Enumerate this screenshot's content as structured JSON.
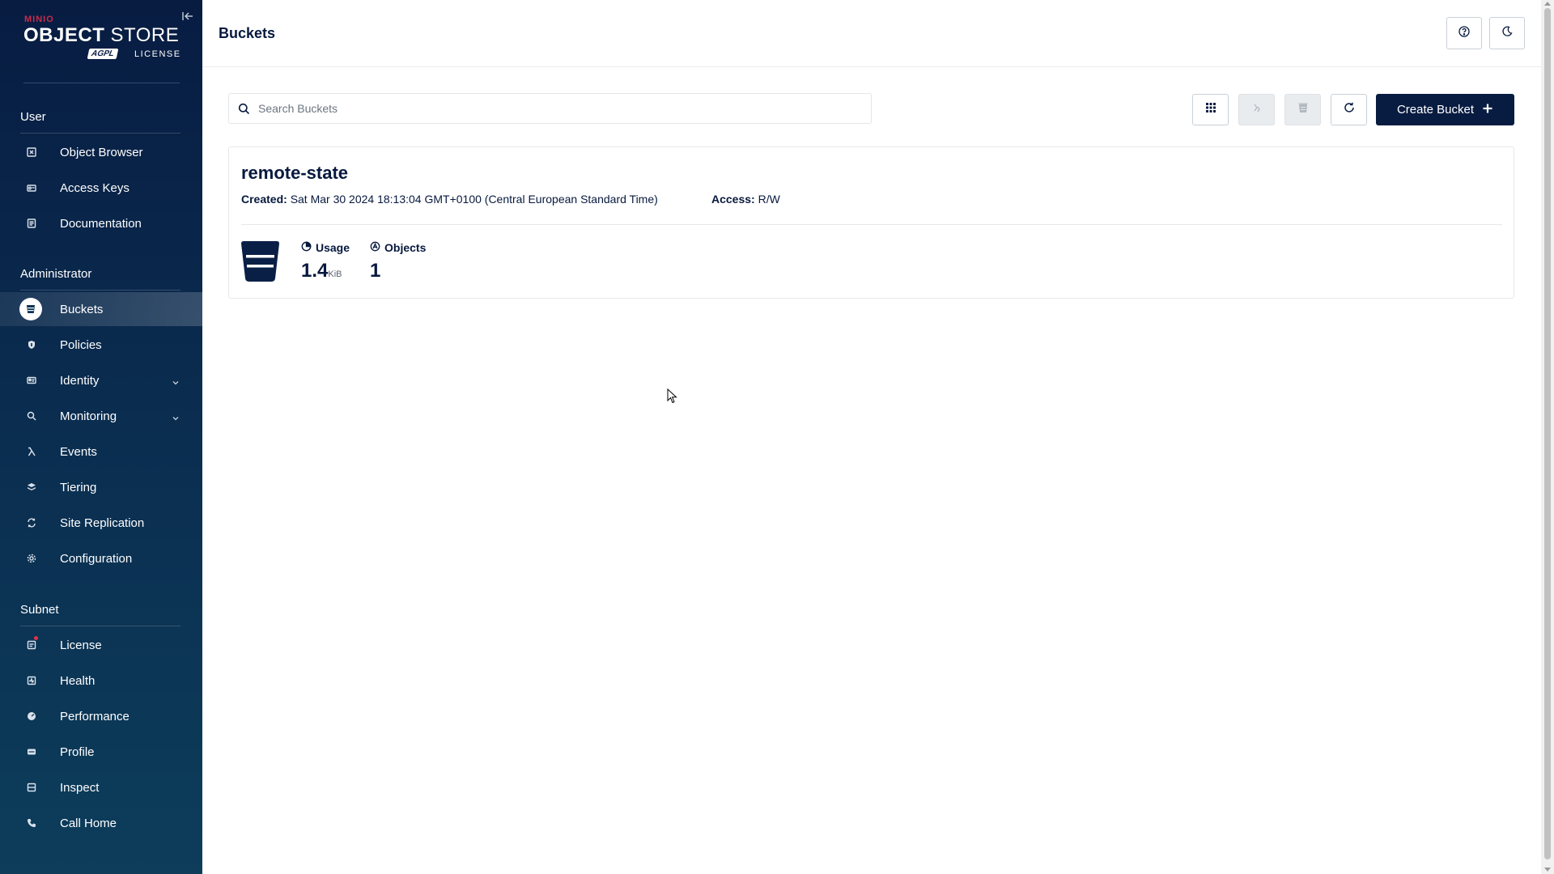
{
  "brand": {
    "small": "MINIO",
    "product_bold": "OBJECT",
    "product_rest": " STORE",
    "badge": "AGPL",
    "license_word": "LICENSE"
  },
  "sidebar": {
    "sections": [
      {
        "title": "User",
        "items": [
          {
            "label": "Object Browser",
            "icon": "object-browser-icon"
          },
          {
            "label": "Access Keys",
            "icon": "access-keys-icon"
          },
          {
            "label": "Documentation",
            "icon": "documentation-icon"
          }
        ]
      },
      {
        "title": "Administrator",
        "items": [
          {
            "label": "Buckets",
            "icon": "buckets-icon",
            "active": true
          },
          {
            "label": "Policies",
            "icon": "policies-icon"
          },
          {
            "label": "Identity",
            "icon": "identity-icon",
            "expandable": true
          },
          {
            "label": "Monitoring",
            "icon": "monitoring-icon",
            "expandable": true
          },
          {
            "label": "Events",
            "icon": "lambda-icon"
          },
          {
            "label": "Tiering",
            "icon": "tiering-icon"
          },
          {
            "label": "Site Replication",
            "icon": "site-replication-icon"
          },
          {
            "label": "Configuration",
            "icon": "gear-icon"
          }
        ]
      },
      {
        "title": "Subnet",
        "items": [
          {
            "label": "License",
            "icon": "license-icon"
          },
          {
            "label": "Health",
            "icon": "health-icon"
          },
          {
            "label": "Performance",
            "icon": "performance-icon"
          },
          {
            "label": "Profile",
            "icon": "profile-icon"
          },
          {
            "label": "Inspect",
            "icon": "inspect-icon"
          },
          {
            "label": "Call Home",
            "icon": "call-home-icon"
          }
        ]
      }
    ]
  },
  "header": {
    "title": "Buckets",
    "help_icon": "help-icon",
    "theme_icon": "moon-icon"
  },
  "toolbar": {
    "search_placeholder": "Search Buckets",
    "search_value": "",
    "create_label": "Create Bucket",
    "buttons": [
      {
        "icon": "grid-icon",
        "disabled": false
      },
      {
        "icon": "replication-icon",
        "disabled": true
      },
      {
        "icon": "delete-icon",
        "disabled": true
      },
      {
        "icon": "refresh-icon",
        "disabled": false
      }
    ]
  },
  "buckets": [
    {
      "name": "remote-state",
      "created_label": "Created:",
      "created_value": "Sat Mar 30 2024 18:13:04 GMT+0100 (Central European Standard Time)",
      "access_label": "Access:",
      "access_value": "R/W",
      "usage_label": "Usage",
      "usage_value": "1.4",
      "usage_unit": "KiB",
      "objects_label": "Objects",
      "objects_value": "1"
    }
  ],
  "colors": {
    "sidebar_top": "#081c42",
    "sidebar_bottom": "#0d3d5b",
    "primary": "#081c42",
    "accent": "#c72c48"
  }
}
